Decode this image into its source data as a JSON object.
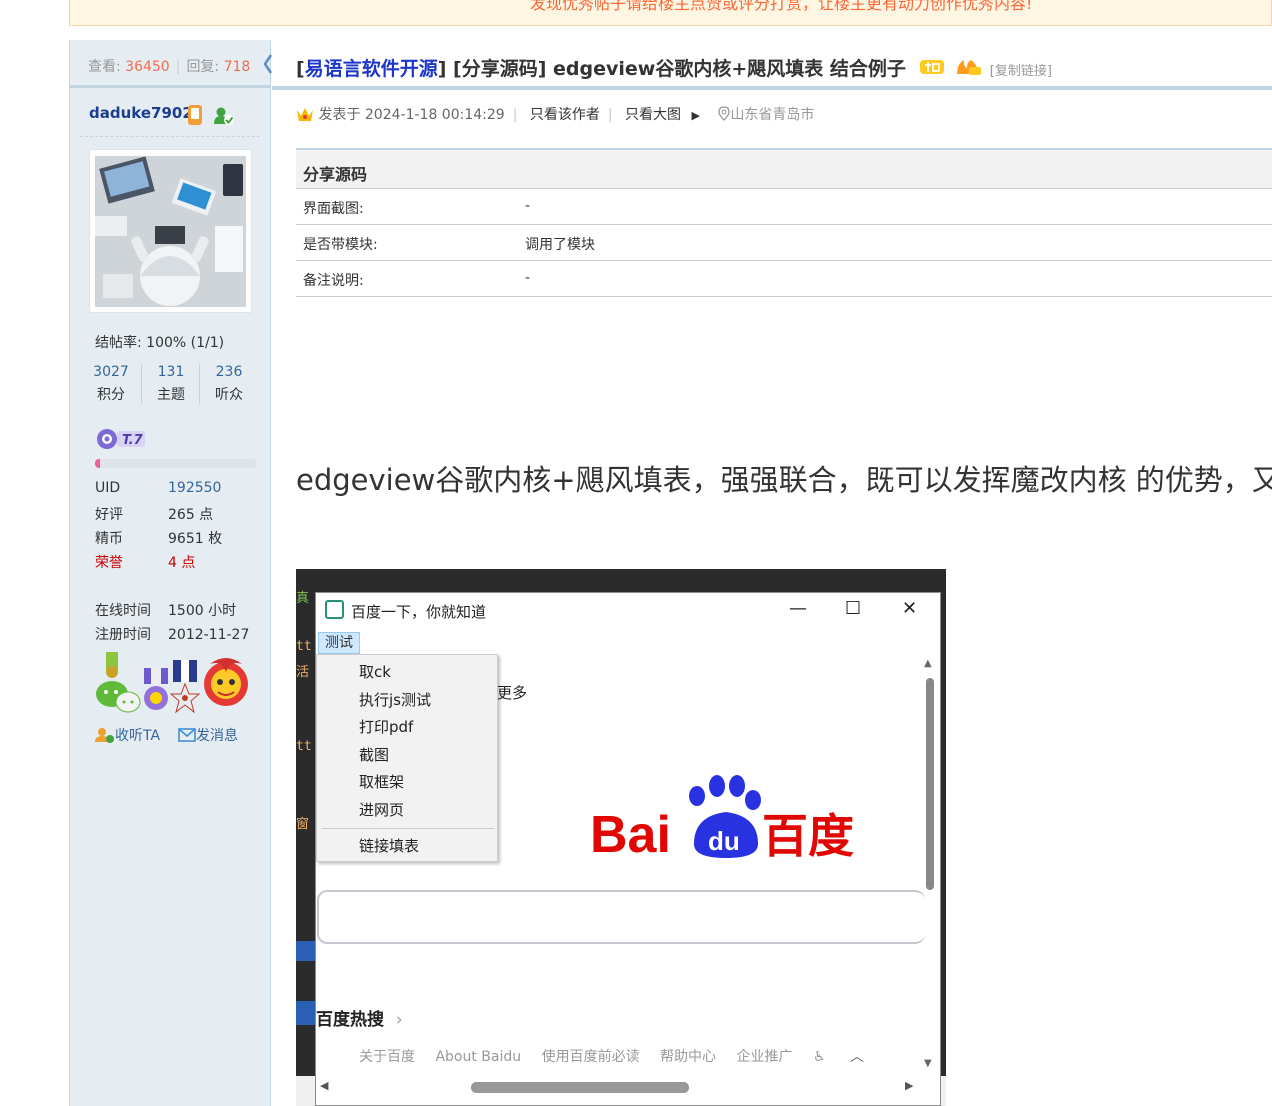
{
  "notice": {
    "text": "发现优秀帖子请给楼主点赞或评分打赏，让楼主更有动力创作优秀内容!"
  },
  "sidebar": {
    "views_label": "查看:",
    "views": "36450",
    "replies_label": "回复:",
    "replies": "718",
    "username": "daduke7902",
    "rate": "结帖率: 100% (1/1)",
    "counts": [
      {
        "num": "3027",
        "label": "积分"
      },
      {
        "num": "131",
        "label": "主题"
      },
      {
        "num": "236",
        "label": "听众"
      }
    ],
    "level": "T.7",
    "level_progress": 0.03,
    "info": [
      {
        "key": "UID",
        "value": "192550",
        "key_color": "#333333",
        "value_color": "#336699"
      },
      {
        "key": "好评",
        "value": "265 点",
        "key_color": "#333333",
        "value_color": "#333333"
      },
      {
        "key": "精币",
        "value": "9651 枚",
        "key_color": "#333333",
        "value_color": "#333333"
      },
      {
        "key": "荣誉",
        "value": "4 点",
        "key_color": "#cc0000",
        "value_color": "#cc0000"
      }
    ],
    "time": [
      {
        "key": "在线时间",
        "value": "1500 小时"
      },
      {
        "key": "注册时间",
        "value": "2012-11-27"
      }
    ],
    "follow": "收听TA",
    "message": "发消息"
  },
  "post": {
    "forum": "易语言软件开源",
    "category": "[分享源码]",
    "title": "edgeview谷歌内核+飓风填表 结合例子",
    "copy_link": "[复制链接]",
    "posted": "发表于 2024-1-18 00:14:29",
    "only_author": "只看该作者",
    "only_images": "只看大图",
    "location": "山东省青岛市",
    "table_header": "分享源码",
    "table_rows": [
      {
        "key": "界面截图:",
        "value": "-"
      },
      {
        "key": "是否带模块:",
        "value": "调用了模块"
      },
      {
        "key": "备注说明:",
        "value": "-"
      }
    ],
    "body": "edgeview谷歌内核+飓风填表，强强联合，既可以发挥魔改内核 的优势，又"
  },
  "screenshot": {
    "window_title": "百度一下，你就知道",
    "menu": "测试",
    "menu_items": [
      "取ck",
      "执行js测试",
      "打印pdf",
      "截图",
      "取框架",
      "进网页",
      "链接填表"
    ],
    "more": "更多",
    "logo_left": "Bai",
    "logo_mid": "du",
    "logo_right": "百度",
    "hot": "百度热搜",
    "footer_links": [
      "关于百度",
      "About Baidu",
      "使用百度前必读",
      "帮助中心",
      "企业推广"
    ],
    "colors": {
      "baidu_red": "#e10602",
      "baidu_blue": "#2932e1"
    }
  }
}
